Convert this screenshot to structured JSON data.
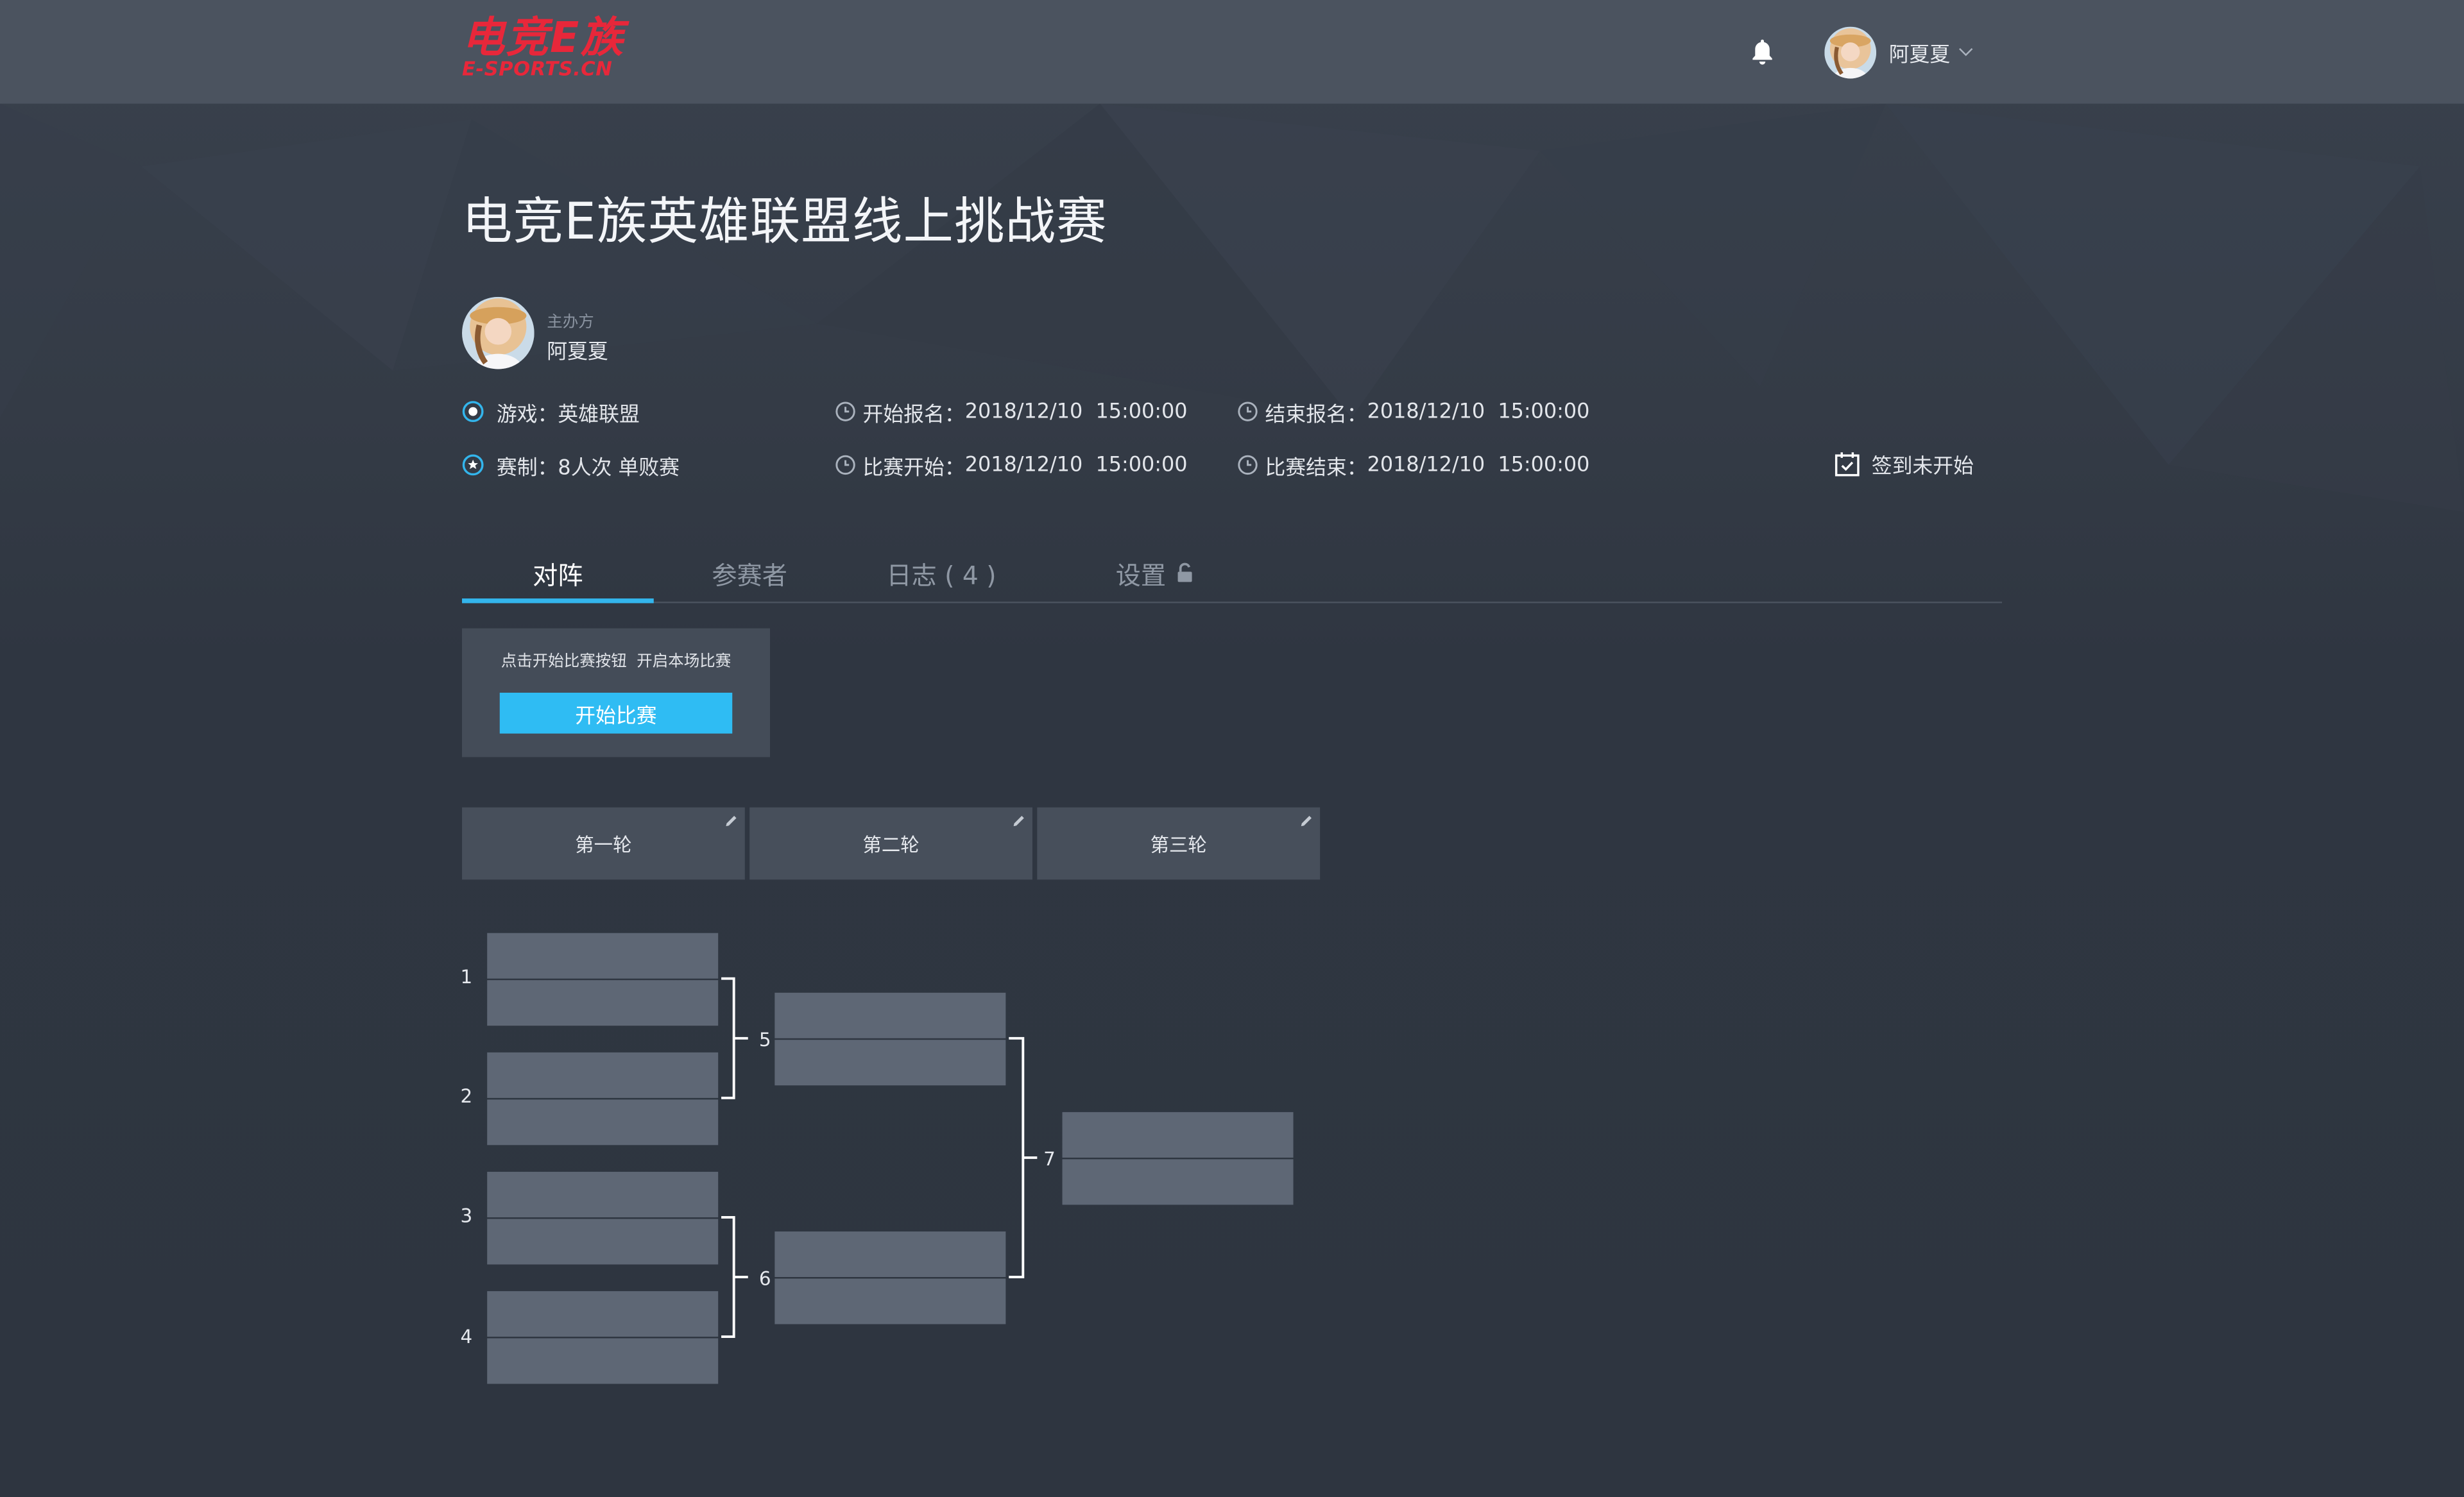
{
  "header": {
    "logo_cn": "电竞E族",
    "logo_en": "E-SPORTS.CN",
    "user_name": "阿夏夏"
  },
  "event": {
    "title": "电竞E族英雄联盟线上挑战赛",
    "host_label": "主办方",
    "host_name": "阿夏夏",
    "game_label": "游戏：",
    "game_value": "英雄联盟",
    "format_label": "赛制：",
    "format_value": "8人次  单败赛",
    "reg_start_label": "开始报名：",
    "reg_start_value": "2018/12/10  15:00:00",
    "reg_end_label": "结束报名：",
    "reg_end_value": "2018/12/10  15:00:00",
    "match_start_label": "比赛开始：",
    "match_start_value": "2018/12/10  15:00:00",
    "match_end_label": "比赛结束：",
    "match_end_value": "2018/12/10  15:00:00",
    "checkin_status": "签到未开始"
  },
  "tabs": [
    {
      "label": "对阵",
      "active": true
    },
    {
      "label": "参赛者",
      "active": false
    },
    {
      "label": "日志 ( 4 )",
      "active": false
    },
    {
      "label": "设置",
      "active": false
    }
  ],
  "start_panel": {
    "hint": "点击开始比赛按钮  开启本场比赛",
    "button_label": "开始比赛"
  },
  "rounds": [
    "第一轮",
    "第二轮",
    "第三轮"
  ],
  "matches": [
    "1",
    "2",
    "3",
    "4",
    "5",
    "6",
    "7"
  ],
  "colors": {
    "accent": "#33b5ec",
    "button": "#2fbcf3",
    "logo_red": "#e8273a",
    "slot": "#5e6775",
    "background": "#2e3540",
    "topbar": "#4b535f"
  },
  "icons": [
    "bell-icon",
    "chevron-down-icon",
    "radio-icon",
    "star-badge-icon",
    "clock-icon",
    "calendar-check-icon",
    "lock-icon",
    "pencil-icon"
  ]
}
